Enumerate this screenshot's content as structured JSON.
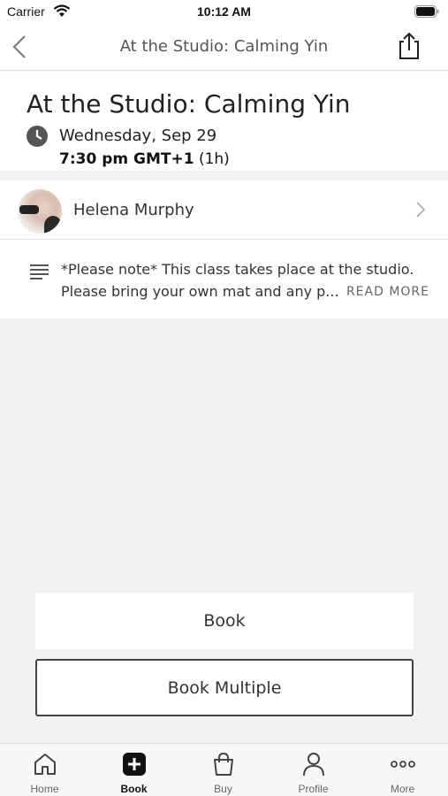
{
  "status_bar": {
    "carrier": "Carrier",
    "time": "10:12 AM"
  },
  "nav": {
    "title": "At the Studio: Calming Yin",
    "back_icon": "chevron-left-icon",
    "share_icon": "share-icon"
  },
  "class": {
    "title": "At the Studio: Calming Yin",
    "date": "Wednesday, Sep 29",
    "time": "7:30 pm GMT+1",
    "duration": "(1h)"
  },
  "instructor": {
    "name": "Helena Murphy"
  },
  "description": {
    "line1": "*Please note* This class takes place at the studio.",
    "line2": "Please bring your own mat and any p...",
    "read_more": "READ MORE"
  },
  "actions": {
    "book": "Book",
    "book_multiple": "Book Multiple"
  },
  "tabs": [
    {
      "label": "Home",
      "icon": "home-icon",
      "active": false
    },
    {
      "label": "Book",
      "icon": "plus-square-icon",
      "active": true
    },
    {
      "label": "Buy",
      "icon": "shopping-bag-icon",
      "active": false
    },
    {
      "label": "Profile",
      "icon": "person-icon",
      "active": false
    },
    {
      "label": "More",
      "icon": "more-dots-icon",
      "active": false
    }
  ],
  "colors": {
    "background": "#f2f2f2",
    "card": "#ffffff",
    "text": "#222222",
    "accent": "#222222"
  }
}
